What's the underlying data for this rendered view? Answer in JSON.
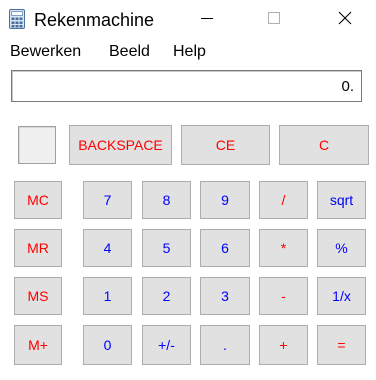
{
  "window": {
    "title": "Rekenmachine"
  },
  "menu": {
    "items": [
      "Bewerken",
      "Beeld",
      "Help"
    ]
  },
  "display": {
    "value": "0."
  },
  "colors": {
    "operator_text": "#ff0000",
    "digit_text": "#0000ff",
    "button_bg": "#e1e1e1"
  },
  "buttons": {
    "backspace": "BACKSPACE",
    "ce": "CE",
    "c": "C",
    "mc": "MC",
    "mr": "MR",
    "ms": "MS",
    "mplus": "M+",
    "d7": "7",
    "d8": "8",
    "d9": "9",
    "div": "/",
    "sqrt": "sqrt",
    "d4": "4",
    "d5": "5",
    "d6": "6",
    "mul": "*",
    "pct": "%",
    "d1": "1",
    "d2": "2",
    "d3": "3",
    "sub": "-",
    "inv": "1/x",
    "d0": "0",
    "sign": "+/-",
    "dot": ".",
    "add": "+",
    "eq": "="
  }
}
